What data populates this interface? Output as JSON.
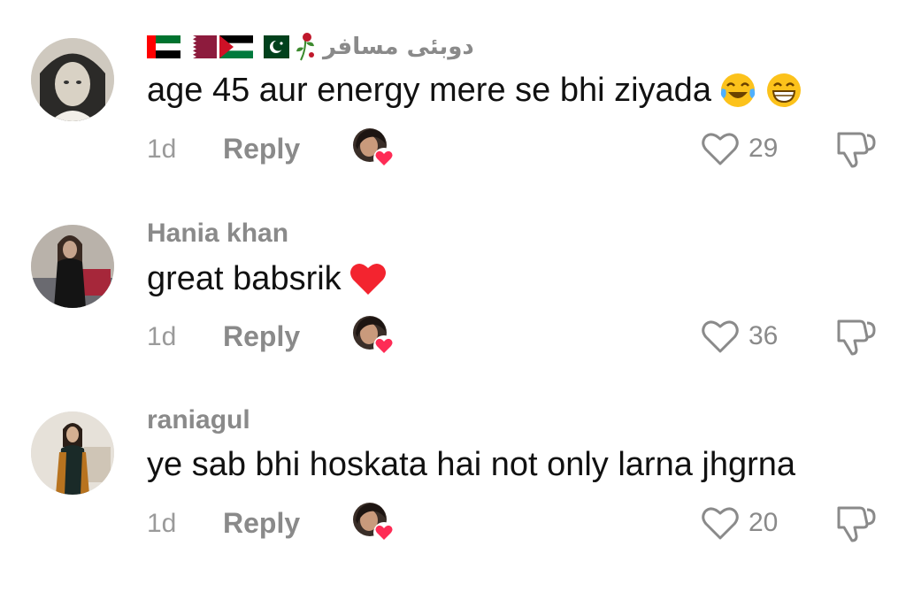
{
  "comments": [
    {
      "username": "دوبئی مسافر",
      "text": "age 45 aur energy mere se bhi ziyada",
      "time": "1d",
      "reply_label": "Reply",
      "likes": "29"
    },
    {
      "username": "Hania khan",
      "text": "great babsrik",
      "time": "1d",
      "reply_label": "Reply",
      "likes": "36"
    },
    {
      "username": "raniagul",
      "text": "ye sab bhi hoskata hai not only larna jhgrna",
      "time": "1d",
      "reply_label": "Reply",
      "likes": "20"
    }
  ],
  "icons": {
    "like": "heart-outline-icon",
    "dislike": "thumbs-down-icon",
    "creator_liked": "creator-liked-heart-icon"
  },
  "colors": {
    "heart_red": "#fe2c55",
    "meta_gray": "#8a8a8a",
    "text": "#111111"
  }
}
